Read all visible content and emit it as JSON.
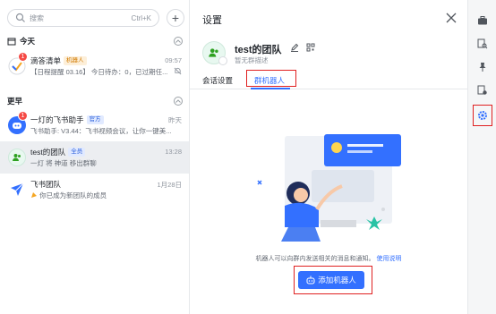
{
  "search": {
    "placeholder": "搜索",
    "shortcut": "Ctrl+K"
  },
  "sections": {
    "today": "今天",
    "earlier": "更早"
  },
  "chats": [
    {
      "name": "滴答清单",
      "tag": "机器人",
      "time": "09:57",
      "preview": "【日程提醒 03.16】 今日待办：0，已过期任...",
      "unread": "1"
    },
    {
      "name": "一灯的飞书助手",
      "tag": "官方",
      "time": "昨天",
      "preview": "飞书助手: V3.44：飞书视频会议，让你一键美...",
      "unread": "1"
    },
    {
      "name": "test的团队",
      "tag": "全员",
      "time": "13:28",
      "preview": "一灯 将 神道 移出群聊"
    },
    {
      "name": "飞书团队",
      "tag": "",
      "time": "1月28日",
      "preview": "你已成为新团队的成员"
    }
  ],
  "settings": {
    "title": "设置",
    "group_name": "test的团队",
    "group_desc": "暂无群描述",
    "tabs": [
      "会话设置",
      "群机器人"
    ],
    "active_tab": "群机器人",
    "description": "机器人可以向群内发送相关的消息和通知。",
    "help_link": "使用说明",
    "add_button": "添加机器人"
  },
  "toolbar": {
    "icons": [
      "briefcase-icon",
      "search-doc-icon",
      "pin-icon",
      "file-settings-icon",
      "settings-gear-icon"
    ],
    "active": "settings-gear-icon"
  },
  "colors": {
    "accent": "#3370ff",
    "highlight_box": "#e02020",
    "badge": "#f54a45"
  }
}
